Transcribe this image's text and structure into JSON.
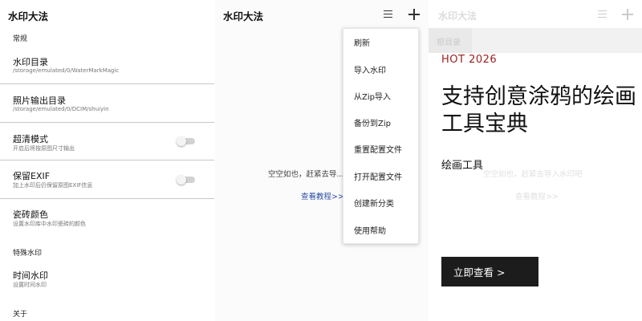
{
  "left_screen": {
    "title": "水印大法",
    "sections": [
      {
        "label": "常规"
      },
      {
        "label": "特殊水印"
      },
      {
        "label": "关于"
      }
    ],
    "rows": [
      {
        "title": "水印目录",
        "subtitle": "/storage/emulated/0/WaterMarkMagic"
      },
      {
        "title": "照片输出目录",
        "subtitle": "/storage/emulated/0/DCIM/shuiyin"
      },
      {
        "title": "超清模式",
        "subtitle": "开启后将按原图尺寸输出",
        "toggle": false
      },
      {
        "title": "保留EXIF",
        "subtitle": "加上水印后仍保留原图EXIF信息",
        "toggle": false
      },
      {
        "title": "瓷砖颜色",
        "subtitle": "设置水印库中水印瓷砖的颜色"
      },
      {
        "title": "时间水印",
        "subtitle": "设置时间水印"
      }
    ]
  },
  "middle_screen": {
    "title": "水印大法",
    "icons": {
      "menu": "hamburger-menu-icon",
      "add": "plus-icon"
    },
    "empty_text": "空空如也，赶紧去导...",
    "tutorial_link": "查看教程>>",
    "menu_items": [
      "刷新",
      "导入水印",
      "从Zip导入",
      "备份到Zip",
      "重置配置文件",
      "打开配置文件",
      "创建新分类",
      "使用帮助"
    ]
  },
  "right_screen": {
    "background_title": "水印大法",
    "background_tab": "根目录",
    "background_empty_text": "空空如也，赶紧去导入水印吧",
    "background_tutorial_link": "查看教程>>",
    "ad": {
      "tag": "HOT 2026",
      "headline": "支持创意涂鸦的绘画工具宝典",
      "subtitle": "绘画工具",
      "cta": "立即查看 >"
    }
  },
  "colors": {
    "link": "#2a4fa8",
    "ad_tag": "#9b2020",
    "cta_bg": "#1c1c1c"
  }
}
